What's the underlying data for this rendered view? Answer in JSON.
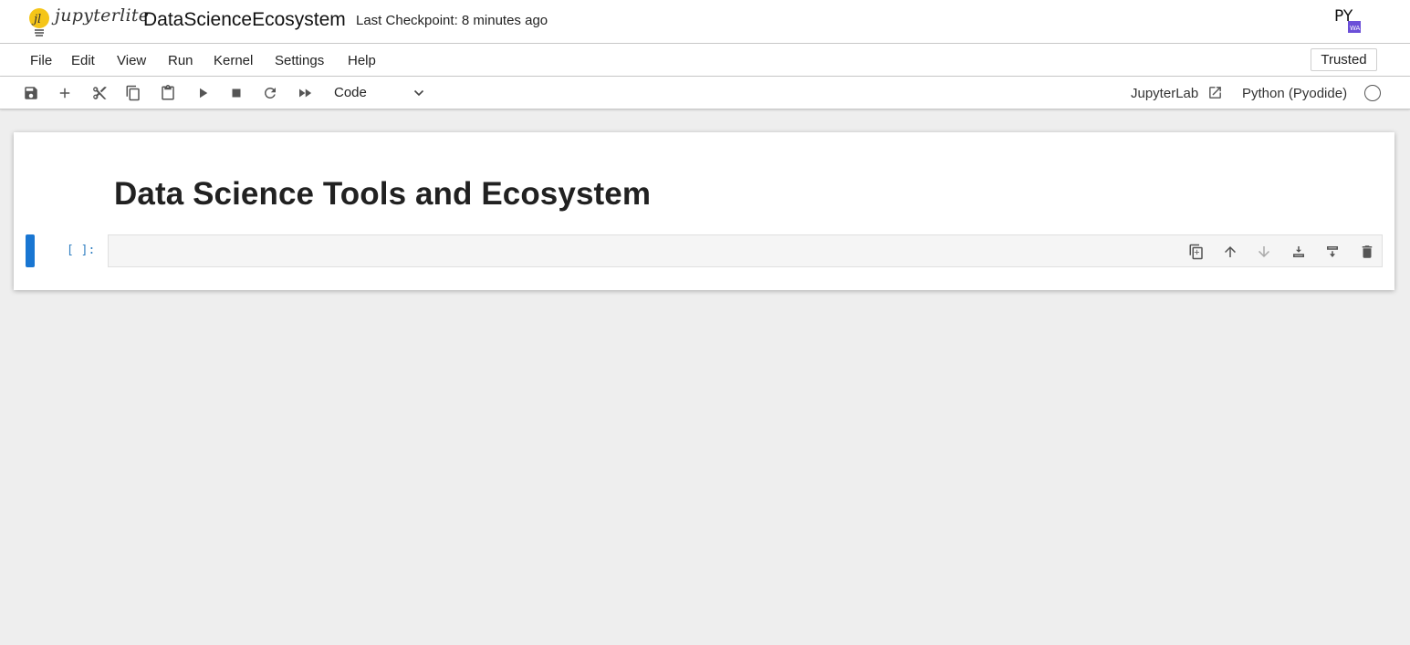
{
  "header": {
    "logo_text": "jupyterlite",
    "notebook_title": "DataScienceEcosystem",
    "checkpoint": "Last Checkpoint: 8 minutes ago",
    "py_logo": "PY"
  },
  "menu": {
    "items": [
      "File",
      "Edit",
      "View",
      "Run",
      "Kernel",
      "Settings",
      "Help"
    ],
    "trusted": "Trusted"
  },
  "toolbar": {
    "icons": [
      "save-icon",
      "add-icon",
      "cut-icon",
      "copy-icon",
      "paste-icon",
      "run-icon",
      "stop-icon",
      "restart-icon",
      "fast-forward-icon"
    ],
    "cell_type": "Code",
    "jupyterlab_link": "JupyterLab",
    "kernel_name": "Python (Pyodide)"
  },
  "notebook": {
    "markdown_heading": "Data Science Tools and Ecosystem",
    "code_prompt": "[ ]:",
    "cell_toolbar_icons": [
      "duplicate-icon",
      "move-up-icon",
      "move-down-icon",
      "insert-above-icon",
      "insert-below-icon",
      "delete-icon"
    ]
  },
  "colors": {
    "accent": "#1976d2",
    "prompt": "#307fc1",
    "background": "#eeeeee"
  }
}
